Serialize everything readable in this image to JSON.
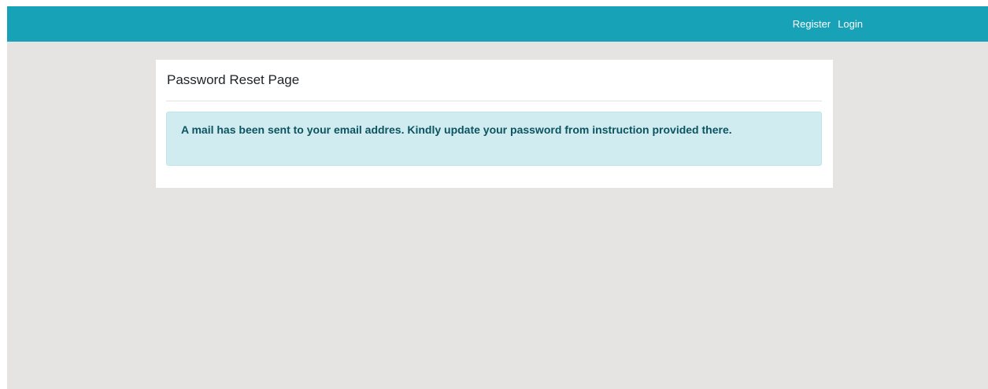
{
  "navbar": {
    "links": [
      {
        "label": "Register"
      },
      {
        "label": "Login"
      }
    ],
    "background_color": "#17a2b8"
  },
  "card": {
    "title": "Password Reset Page",
    "alert": {
      "message": "A mail has been sent to your email addres. Kindly update your password from instruction provided there.",
      "type": "info",
      "background_color": "#d1ecf1",
      "text_color": "#0c5460"
    }
  },
  "page": {
    "background_color": "#e5e4e2"
  }
}
